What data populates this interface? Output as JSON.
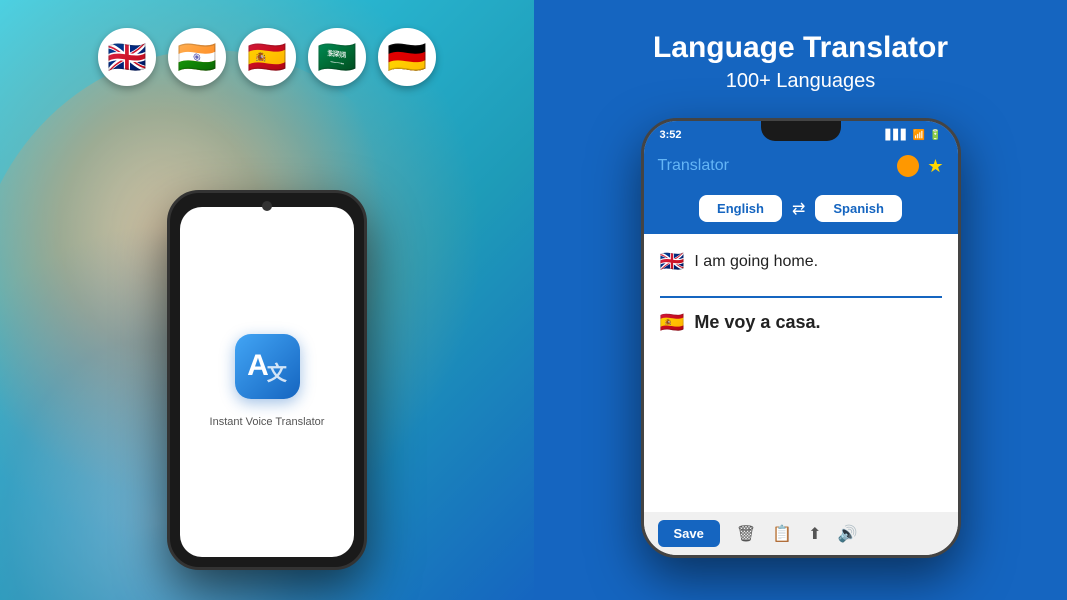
{
  "left": {
    "flags": [
      {
        "emoji": "🇬🇧",
        "label": "UK flag"
      },
      {
        "emoji": "🇮🇳",
        "label": "India flag"
      },
      {
        "emoji": "🇪🇸",
        "label": "Spain flag"
      },
      {
        "emoji": "🇸🇦",
        "label": "Saudi Arabia flag"
      },
      {
        "emoji": "🇩🇪",
        "label": "Germany flag"
      }
    ],
    "phone": {
      "app_label_line1": "Instant Voice Translator"
    }
  },
  "right": {
    "title": "Language Translator",
    "subtitle": "100+ Languages",
    "phone": {
      "status_time": "3:52",
      "status_signal": "▋▋▋",
      "status_wifi": "WiFi",
      "status_battery": "🔋",
      "header_title": "Translator",
      "source_language": "English",
      "target_language": "Spanish",
      "source_flag": "🇬🇧",
      "source_text": "I am going home.",
      "target_flag": "🇪🇸",
      "target_text": "Me voy a casa.",
      "save_button": "Save",
      "toolbar_icons": [
        "🗑",
        "📋",
        "📤",
        "🔊"
      ]
    }
  }
}
